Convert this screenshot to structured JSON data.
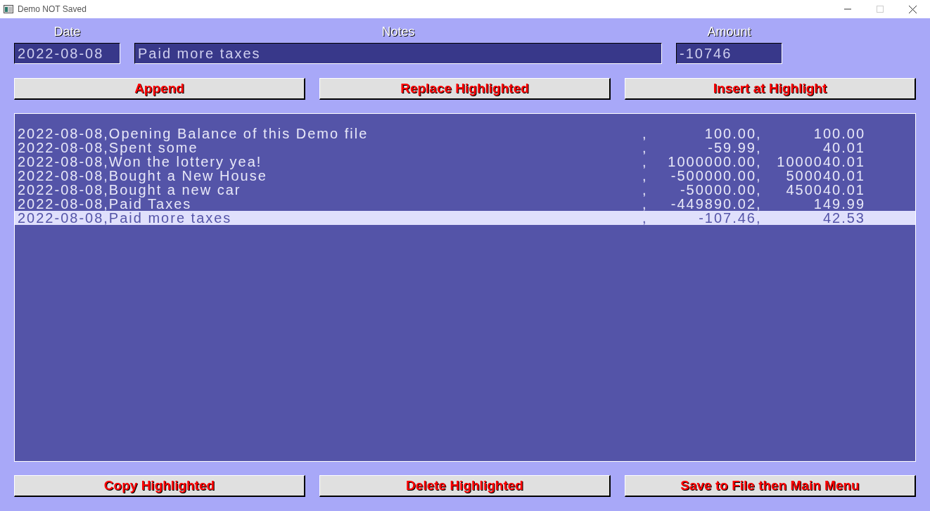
{
  "window": {
    "title": "Demo NOT Saved"
  },
  "fields": [
    {
      "label": "Date",
      "value": "2022-08-08"
    },
    {
      "label": "Notes",
      "value": "Paid more taxes"
    },
    {
      "label": "Amount",
      "value": "-10746"
    }
  ],
  "top_buttons": [
    "Append",
    "Replace Highlighted",
    "Insert at Highlight"
  ],
  "ledger": [
    {
      "entry": "2022-08-08,Opening Balance of this Demo file",
      "amount": "100.00",
      "balance": "100.00",
      "selected": false
    },
    {
      "entry": "2022-08-08,Spent some",
      "amount": "-59.99",
      "balance": "40.01",
      "selected": false
    },
    {
      "entry": "2022-08-08,Won the lottery yea!",
      "amount": "1000000.00",
      "balance": "1000040.01",
      "selected": false
    },
    {
      "entry": "2022-08-08,Bought a New House",
      "amount": "-500000.00",
      "balance": "500040.01",
      "selected": false
    },
    {
      "entry": "2022-08-08,Bought a new car",
      "amount": "-50000.00",
      "balance": "450040.01",
      "selected": false
    },
    {
      "entry": "2022-08-08,Paid Taxes",
      "amount": "-449890.02",
      "balance": "149.99",
      "selected": false
    },
    {
      "entry": "2022-08-08,Paid more taxes",
      "amount": "-107.46",
      "balance": "42.53",
      "selected": true
    }
  ],
  "separator": ",",
  "bottom_buttons": [
    "Copy Highlighted",
    "Delete Highlighted",
    "Save to File then Main Menu"
  ]
}
